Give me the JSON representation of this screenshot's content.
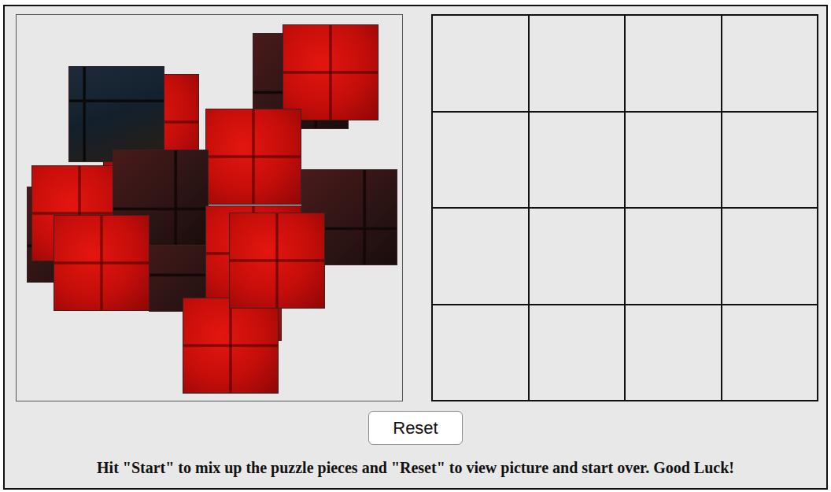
{
  "game": {
    "board": {
      "slots": [
        {
          "filled": false
        },
        {
          "filled": false
        },
        {
          "filled": false
        },
        {
          "filled": false
        },
        {
          "filled": false
        },
        {
          "filled": false
        },
        {
          "filled": false
        },
        {
          "filled": false
        },
        {
          "filled": false
        },
        {
          "filled": false
        },
        {
          "filled": false
        },
        {
          "filled": false
        },
        {
          "filled": false
        },
        {
          "filled": false
        },
        {
          "filled": false
        },
        {
          "filled": false
        }
      ]
    },
    "pieces": [
      {
        "placed": false
      },
      {
        "placed": false
      },
      {
        "placed": false
      },
      {
        "placed": false
      },
      {
        "placed": false
      },
      {
        "placed": false
      },
      {
        "placed": false
      },
      {
        "placed": false
      },
      {
        "placed": false
      },
      {
        "placed": false
      },
      {
        "placed": false
      },
      {
        "placed": false
      },
      {
        "placed": false
      },
      {
        "placed": false
      },
      {
        "placed": false
      },
      {
        "placed": false
      }
    ],
    "buttons": [
      "Reset"
    ],
    "instructions": "Hit \"Start\" to mix up the puzzle pieces and \"Reset\" to view picture and start over. Good Luck!"
  }
}
